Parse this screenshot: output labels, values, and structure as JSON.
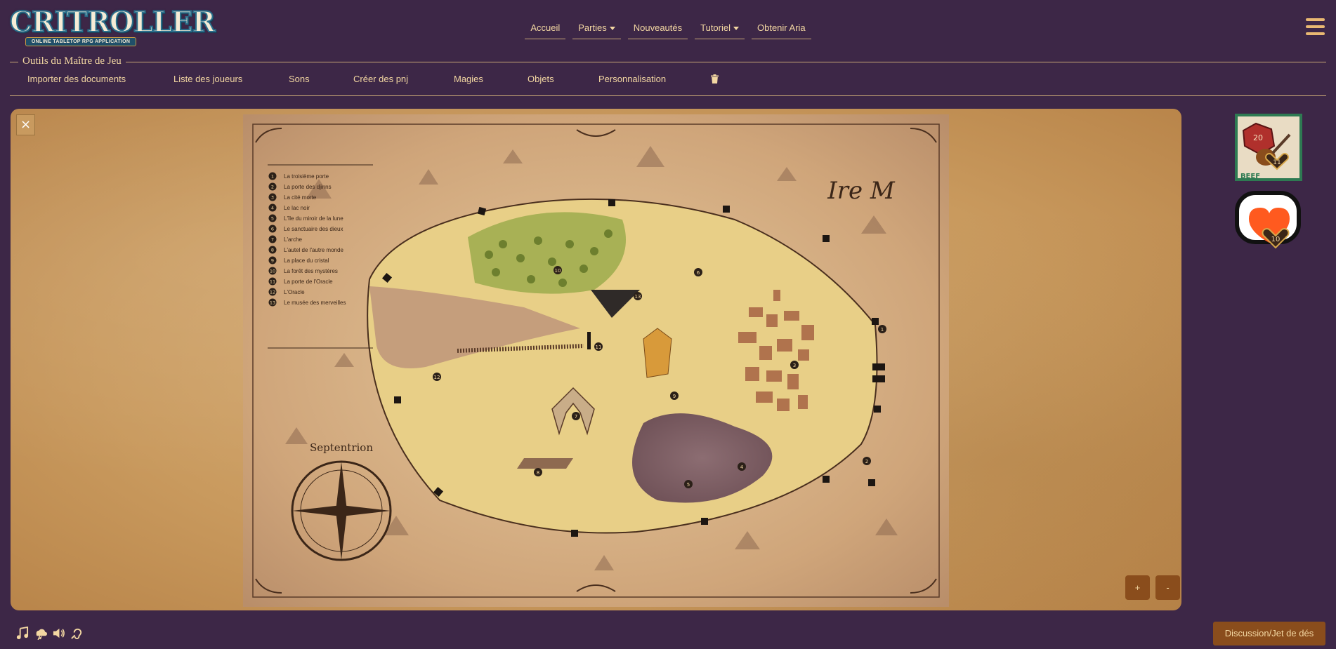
{
  "brand": {
    "logo_text": "CRITROLLER",
    "logo_subtitle": "ONLINE TABLETOP RPG APPLICATION"
  },
  "nav": {
    "items": [
      {
        "label": "Accueil",
        "has_dropdown": false
      },
      {
        "label": "Parties",
        "has_dropdown": true
      },
      {
        "label": "Nouveautés",
        "has_dropdown": false
      },
      {
        "label": "Tutoriel",
        "has_dropdown": true
      },
      {
        "label": "Obtenir Aria",
        "has_dropdown": false
      }
    ],
    "menu_icon": "hamburger-icon"
  },
  "gm_tools": {
    "title": "Outils du Maître de Jeu",
    "items": [
      "Importer des documents",
      "Liste des joueurs",
      "Sons",
      "Créer des pnj",
      "Magies",
      "Objets",
      "Personnalisation"
    ],
    "delete_icon": "trash-icon"
  },
  "map": {
    "close_label": "×",
    "signature": "Ire M",
    "compass_title": "Septentrion",
    "legend": [
      {
        "num": "1",
        "label": "La troisième porte"
      },
      {
        "num": "2",
        "label": "La porte des djinns"
      },
      {
        "num": "3",
        "label": "La cité morte"
      },
      {
        "num": "4",
        "label": "Le lac noir"
      },
      {
        "num": "5",
        "label": "L'île du miroir de la lune"
      },
      {
        "num": "6",
        "label": "Le sanctuaire des dieux"
      },
      {
        "num": "7",
        "label": "L'arche"
      },
      {
        "num": "8",
        "label": "L'autel de l'autre monde"
      },
      {
        "num": "9",
        "label": "La place du cristal"
      },
      {
        "num": "10",
        "label": "La forêt des mystères"
      },
      {
        "num": "11",
        "label": "La porte de l'Oracle"
      },
      {
        "num": "12",
        "label": "L'Oracle"
      },
      {
        "num": "13",
        "label": "Le musée des merveilles"
      }
    ],
    "zoom_in_label": "+",
    "zoom_out_label": "-"
  },
  "badges": {
    "dice_badge": {
      "die_label": "20",
      "heart_count": "11",
      "caption": "BEEF"
    },
    "mug_badge": {
      "heart_count": "10"
    }
  },
  "footer": {
    "audio_icons": [
      "music-icon",
      "weather-icon",
      "volume-icon",
      "hearing-icon"
    ],
    "chat_button": "Discussion/Jet de dés"
  },
  "colors": {
    "background": "#3d2747",
    "accent_text": "#f3d7a2",
    "button_brown": "#8a4d1c",
    "parchment": "#d8b07a"
  }
}
